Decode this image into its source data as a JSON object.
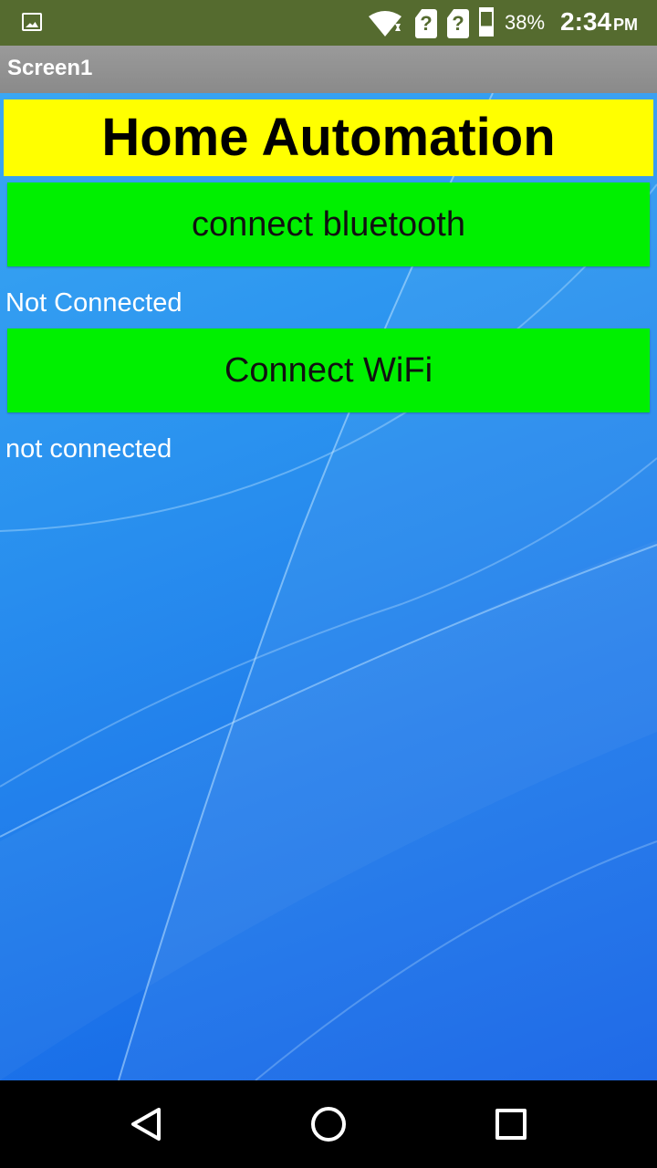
{
  "status_bar": {
    "battery": "38%",
    "time": "2:34",
    "ampm": "PM",
    "sim1_icon": "?",
    "sim2_icon": "?"
  },
  "app": {
    "screen_title": "Screen1"
  },
  "main": {
    "heading": "Home Automation",
    "bluetooth_button": "connect bluetooth",
    "bluetooth_status": "Not Connected",
    "wifi_button": "Connect WiFi",
    "wifi_status": "not connected"
  },
  "colors": {
    "status_bar": "#556b2f",
    "title_bar": "#909090",
    "heading_bg": "#ffff00",
    "button_bg": "#00f000",
    "background": "#2a92ef"
  },
  "icons": [
    "gallery-icon",
    "wifi-icon",
    "sim-unknown-icon",
    "battery-icon",
    "back-icon",
    "home-icon",
    "recents-icon"
  ]
}
